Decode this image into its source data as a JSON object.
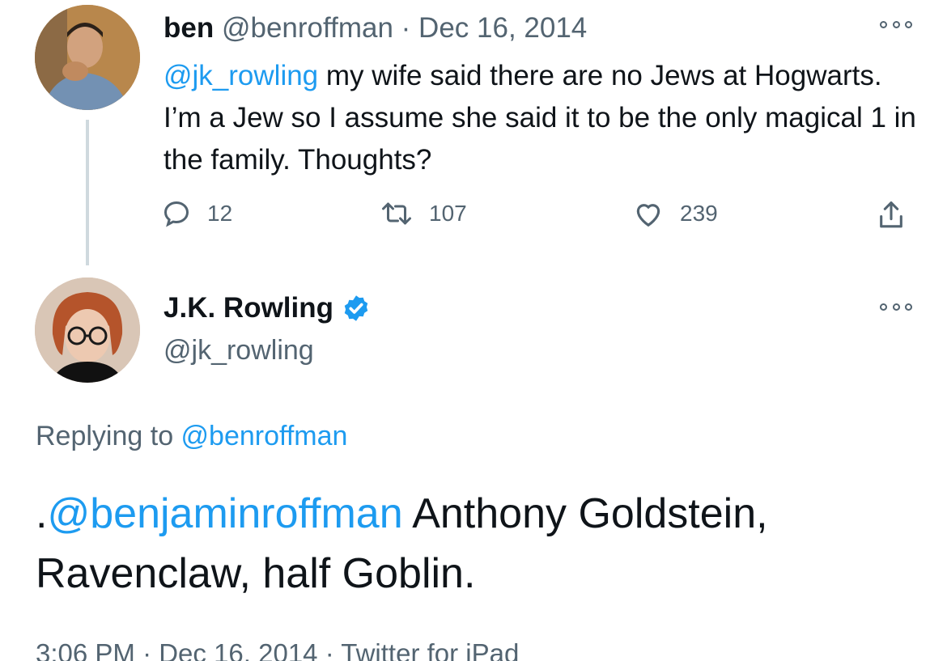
{
  "parent_tweet": {
    "display_name": "ben",
    "handle": "@benroffman",
    "separator": "·",
    "date": "Dec 16, 2014",
    "mention": "@jk_rowling",
    "text": " my wife said there are no Jews at Hogwarts. I’m a Jew so I assume she said it to be the only magical 1 in the family. Thoughts?",
    "reply_count": "12",
    "retweet_count": "107",
    "like_count": "239",
    "more_icon": "more-options-icon"
  },
  "reply_tweet": {
    "display_name": "J.K. Rowling",
    "verified_icon": "verified-badge-icon",
    "handle": "@jk_rowling",
    "replying_label": "Replying to ",
    "replying_handle": "@benroffman",
    "text_prefix": ".",
    "mention": "@benjaminroffman",
    "text": " Anthony Goldstein, Ravenclaw, half Goblin.",
    "timestamp": "3:06 PM · Dec 16, 2014 · Twitter for iPad"
  },
  "colors": {
    "link": "#1d9bf0",
    "muted": "#536471",
    "text": "#0f1419",
    "verified": "#1d9bf0"
  }
}
